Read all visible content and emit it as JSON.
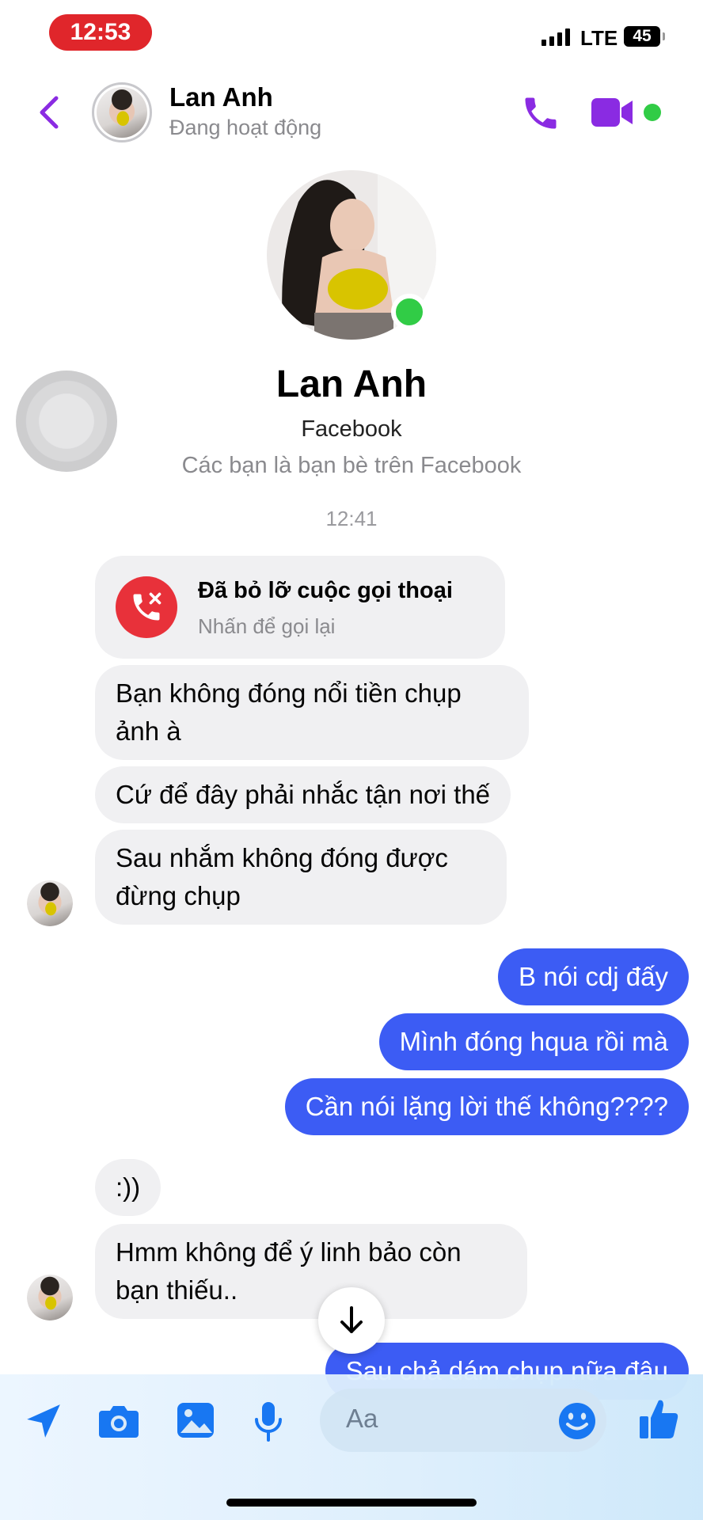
{
  "status_bar": {
    "time": "12:53",
    "network": "LTE",
    "battery": "45"
  },
  "header": {
    "name": "Lan Anh",
    "status": "Đang hoạt động"
  },
  "profile": {
    "name": "Lan Anh",
    "subtitle": "Facebook",
    "friends_note": "Các bạn là bạn bè trên Facebook"
  },
  "conversation": {
    "timestamp": "12:41",
    "missed_call": {
      "title": "Đã bỏ lỡ cuộc gọi thoại",
      "subtitle": "Nhấn để gọi lại"
    },
    "messages": [
      {
        "direction": "in",
        "text": "Bạn không đóng nổi tiền chụp ảnh à"
      },
      {
        "direction": "in",
        "text": "Cứ để đây phải nhắc tận nơi thế"
      },
      {
        "direction": "in",
        "text": "Sau nhắm không đóng được đừng chụp"
      },
      {
        "direction": "out",
        "text": "B nói cdj đấy"
      },
      {
        "direction": "out",
        "text": "Mình đóng hqua rồi mà"
      },
      {
        "direction": "out",
        "text": "Cần nói lặng lời thế không????"
      },
      {
        "direction": "in",
        "text": ":))"
      },
      {
        "direction": "in",
        "text": "Hmm không để ý linh bảo còn bạn thiếu.."
      },
      {
        "direction": "out",
        "text": "Sau chả dám chụp nữa đâu"
      }
    ]
  },
  "composer": {
    "placeholder": "Aa"
  },
  "colors": {
    "accent": "#8a2be2",
    "outgoing_bubble": "#3c5cf4",
    "incoming_bubble": "#f0f0f2",
    "online": "#31cc46",
    "missed_call": "#e8313a",
    "composer_icon": "#1877f2"
  },
  "icons": [
    "back-icon",
    "phone-icon",
    "video-icon",
    "missed-call-icon",
    "arrow-down-icon",
    "send-location-icon",
    "camera-icon",
    "gallery-icon",
    "microphone-icon",
    "emoji-icon",
    "thumbs-up-icon"
  ]
}
